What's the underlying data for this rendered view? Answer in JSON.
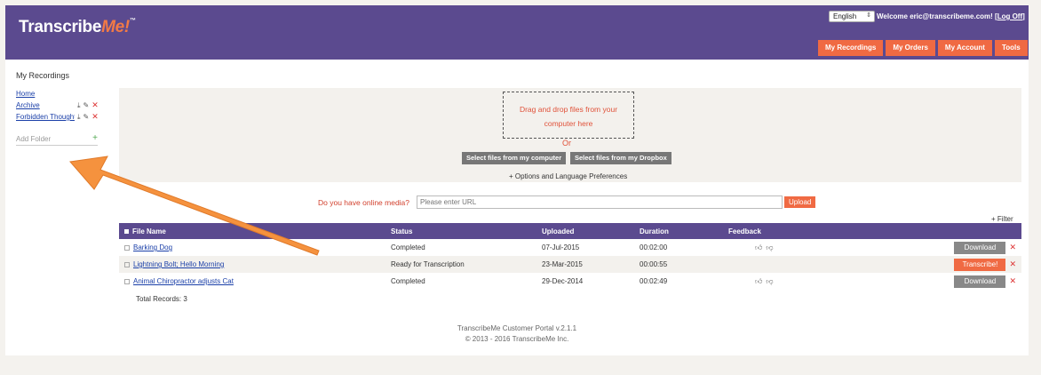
{
  "header": {
    "logo_main": "Transcribe",
    "logo_accent": "Me!",
    "logo_tm": "™",
    "language": "English",
    "welcome_text": "Welcome eric@transcribeme.com! [",
    "logout_label": "Log Off",
    "welcome_end": "]",
    "nav": [
      {
        "label": "My Recordings"
      },
      {
        "label": "My Orders"
      },
      {
        "label": "My Account"
      },
      {
        "label": "Tools"
      }
    ]
  },
  "sidebar": {
    "title": "My Recordings",
    "folders": [
      {
        "label": "Home"
      },
      {
        "label": "Archive"
      },
      {
        "label": "Forbidden Thoughts"
      }
    ],
    "add_folder_placeholder": "Add Folder"
  },
  "upload": {
    "drop_text": "Drag and drop files from your computer here",
    "or_text": "Or",
    "select_computer_label": "Select files from my computer",
    "select_dropbox_label": "Select files from my Dropbox",
    "options_label": "+ Options and Language Preferences",
    "online_media_label": "Do you have online media?",
    "url_placeholder": "Please enter URL",
    "upload_button": "Upload"
  },
  "filter_label": "+ Filter",
  "table": {
    "columns": [
      "File Name",
      "Status",
      "Uploaded",
      "Duration",
      "Feedback"
    ],
    "rows": [
      {
        "name": "Barking Dog",
        "status": "Completed",
        "uploaded": "07-Jul-2015",
        "duration": "00:02:00",
        "action": "Download"
      },
      {
        "name": "Lightning Bolt; Hello Morning",
        "status": "Ready for Transcription",
        "uploaded": "23-Mar-2015",
        "duration": "00:00:55",
        "action": "Transcribe!"
      },
      {
        "name": "Animal Chiropractor adjusts Cat",
        "status": "Completed",
        "uploaded": "29-Dec-2014",
        "duration": "00:02:49",
        "action": "Download"
      }
    ],
    "total_records": "Total Records: 3"
  },
  "footer": {
    "line1": "TranscribeMe Customer Portal v.2.1.1",
    "line2": "© 2013 - 2016 TranscribeMe Inc."
  },
  "colors": {
    "brand_purple": "#5b4a8f",
    "accent_orange": "#f06a43",
    "arrow_orange": "#f5923e"
  }
}
